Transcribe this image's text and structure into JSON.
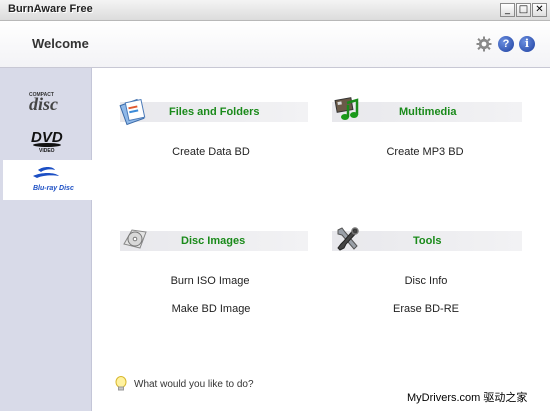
{
  "window": {
    "title": "BurnAware Free",
    "site_mark": "MyDrivers.com 驱动之家",
    "min_label": "_",
    "max_label": "□",
    "close_label": "✕"
  },
  "header": {
    "title": "Welcome",
    "help_label": "?",
    "info_label": "i"
  },
  "sidebar": {
    "items": [
      {
        "name": "Compact Disc",
        "icon": "compact-disc-icon"
      },
      {
        "name": "DVD Video",
        "icon": "dvd-video-icon"
      },
      {
        "name": "Blu-ray Disc",
        "icon": "bluray-disc-icon",
        "active": true
      }
    ]
  },
  "groups": {
    "files": {
      "title": "Files and Folders",
      "icon": "files-folders-icon",
      "actions": [
        "Create Data BD"
      ]
    },
    "multimedia": {
      "title": "Multimedia",
      "icon": "multimedia-icon",
      "actions": [
        "Create MP3 BD"
      ]
    },
    "images": {
      "title": "Disc Images",
      "icon": "disc-images-icon",
      "actions": [
        "Burn ISO Image",
        "Make BD Image"
      ]
    },
    "tools": {
      "title": "Tools",
      "icon": "tools-icon",
      "actions": [
        "Disc Info",
        "Erase BD-RE"
      ]
    }
  },
  "footer": {
    "hint": "What would you like to do?",
    "watermark": "MyDrivers.com 驱动之家"
  },
  "colors": {
    "group_title": "#1a8a1a",
    "sidebar_bg": "#d8dae8",
    "bluray_blue": "#1c4fc4"
  }
}
